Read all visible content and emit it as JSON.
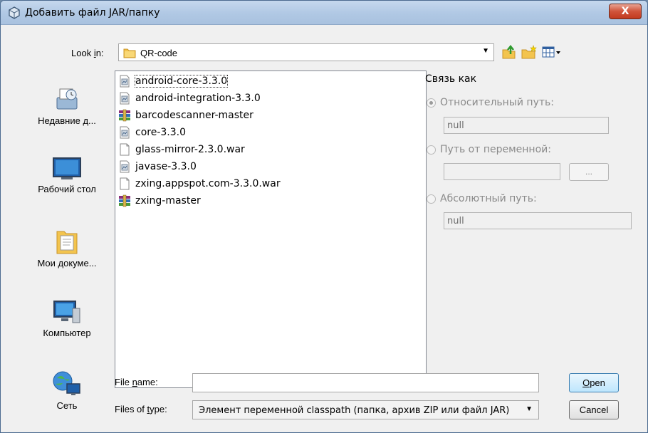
{
  "window": {
    "title": "Добавить файл JAR/папку",
    "close_glyph": "X"
  },
  "look_in": {
    "label_prefix": "Look ",
    "label_mnemonic": "i",
    "label_suffix": "n:",
    "value": "QR-code"
  },
  "toolbar": {
    "up_icon": "up-folder-icon",
    "new_folder_icon": "new-folder-icon",
    "view_icon": "view-menu-icon"
  },
  "places": [
    {
      "label": "Недавние д...",
      "icon": "recent-documents-icon"
    },
    {
      "label": "Рабочий стол",
      "icon": "desktop-icon"
    },
    {
      "label": "Мои докуме...",
      "icon": "my-documents-icon"
    },
    {
      "label": "Компьютер",
      "icon": "computer-icon"
    },
    {
      "label": "Сеть",
      "icon": "network-icon"
    }
  ],
  "files": [
    {
      "name": "android-core-3.3.0",
      "icon": "jar-file-icon",
      "selected": true
    },
    {
      "name": "android-integration-3.3.0",
      "icon": "jar-file-icon"
    },
    {
      "name": "barcodescanner-master",
      "icon": "archive-icon"
    },
    {
      "name": "core-3.3.0",
      "icon": "jar-file-icon"
    },
    {
      "name": "glass-mirror-2.3.0.war",
      "icon": "blank-file-icon"
    },
    {
      "name": "javase-3.3.0",
      "icon": "jar-file-icon"
    },
    {
      "name": "zxing.appspot.com-3.3.0.war",
      "icon": "blank-file-icon"
    },
    {
      "name": "zxing-master",
      "icon": "archive-icon"
    }
  ],
  "link_as": {
    "title": "Связь как",
    "relative_label": "Относительный путь:",
    "relative_value": "null",
    "variable_label": "Путь от переменной:",
    "variable_value": "",
    "browse_label": "...",
    "absolute_label": "Абсолютный путь:",
    "absolute_value": "null"
  },
  "file_name": {
    "label_prefix": "File ",
    "label_mnemonic": "n",
    "label_suffix": "ame:",
    "value": ""
  },
  "file_type": {
    "label_prefix": "Files of ",
    "label_mnemonic": "t",
    "label_suffix": "ype:",
    "value": "Элемент переменной classpath (папка, архив ZIP или файл JAR)"
  },
  "buttons": {
    "open_mnemonic": "O",
    "open_rest": "pen",
    "cancel": "Cancel"
  }
}
